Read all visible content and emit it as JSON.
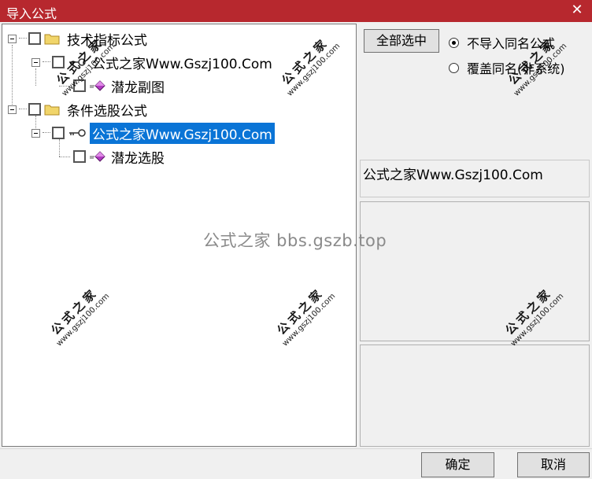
{
  "window": {
    "title": "导入公式",
    "close_glyph": "✕"
  },
  "tree": {
    "nodes": [
      {
        "label": "技术指标公式",
        "icon": "folder-icon"
      },
      {
        "label": "公式之家Www.Gszj100.Com",
        "icon": "key-icon"
      },
      {
        "label": "潜龙副图",
        "icon": "gem-icon"
      },
      {
        "label": "条件选股公式",
        "icon": "folder-icon"
      },
      {
        "label": "公式之家Www.Gszj100.Com",
        "icon": "key-icon",
        "selected": true
      },
      {
        "label": "潜龙选股",
        "icon": "gem-icon"
      }
    ]
  },
  "options": {
    "select_all": "全部选中",
    "radio_no_import": "不导入同名公式",
    "radio_overwrite": "覆盖同名(非系统)",
    "selected": "radio_no_import"
  },
  "info_text": "公式之家Www.Gszj100.Com",
  "buttons": {
    "ok": "确定",
    "cancel": "取消"
  },
  "watermarks": {
    "center": "公式之家 bbs.gszb.top",
    "stamp_title": "公式之家",
    "stamp_url": "www.gszj100.com"
  },
  "colors": {
    "titlebar": "#b7282e",
    "selection": "#0a74d6"
  }
}
